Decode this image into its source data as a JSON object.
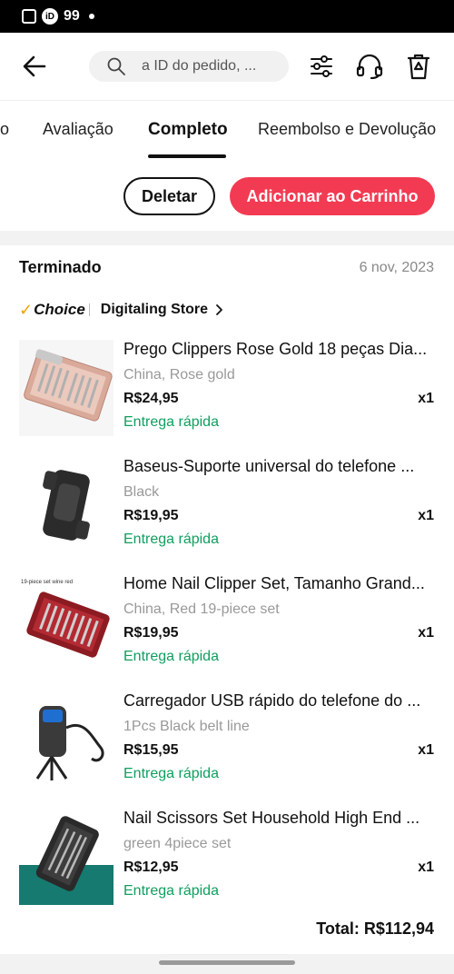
{
  "status_bar": {
    "notification_count": "99"
  },
  "header": {
    "search_placeholder": "a ID do pedido, ..."
  },
  "tabs": [
    {
      "label": "o"
    },
    {
      "label": "Avaliação"
    },
    {
      "label": "Completo",
      "active": true
    },
    {
      "label": "Reembolso e Devolução"
    }
  ],
  "actions": {
    "delete_label": "Deletar",
    "add_to_cart_label": "Adicionar ao Carrinho"
  },
  "order": {
    "status": "Terminado",
    "date": "6 nov, 2023",
    "choice_label": "Choice",
    "store_name": "Digitaling Store",
    "items": [
      {
        "name": "Prego Clippers Rose Gold 18 peças Dia...",
        "variant": "China, Rose gold",
        "price": "R$24,95",
        "qty": "x1",
        "delivery": "Entrega rápida"
      },
      {
        "name": "Baseus-Suporte universal do telefone ...",
        "variant": "Black",
        "price": "R$19,95",
        "qty": "x1",
        "delivery": "Entrega rápida"
      },
      {
        "name": "Home Nail Clipper Set, Tamanho Grand...",
        "variant": "China, Red 19-piece set",
        "price": "R$19,95",
        "qty": "x1",
        "delivery": "Entrega rápida",
        "thumb_text": "19-piece set wine red"
      },
      {
        "name": "Carregador USB rápido do telefone do ...",
        "variant": "1Pcs Black belt line",
        "price": "R$15,95",
        "qty": "x1",
        "delivery": "Entrega rápida"
      },
      {
        "name": "Nail Scissors Set Household High End ...",
        "variant": "green 4piece set",
        "price": "R$12,95",
        "qty": "x1",
        "delivery": "Entrega rápida"
      }
    ],
    "total": "Total: R$112,94"
  },
  "colors": {
    "accent": "#f23b52",
    "delivery_green": "#0e9f5f",
    "choice_orange": "#f5a000"
  }
}
